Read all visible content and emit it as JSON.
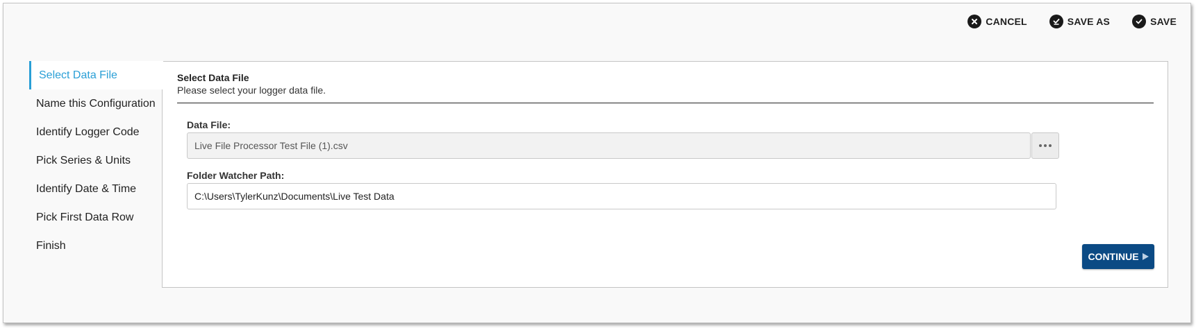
{
  "toolbar": {
    "cancel_label": "CANCEL",
    "save_as_label": "SAVE AS",
    "save_label": "SAVE"
  },
  "sidebar": {
    "items": [
      {
        "label": "Select Data File",
        "active": true
      },
      {
        "label": "Name this Configuration"
      },
      {
        "label": "Identify Logger Code"
      },
      {
        "label": "Pick Series & Units"
      },
      {
        "label": "Identify Date & Time"
      },
      {
        "label": "Pick First Data Row"
      },
      {
        "label": "Finish"
      }
    ]
  },
  "panel": {
    "title": "Select Data File",
    "subtitle": "Please select your logger data file.",
    "data_file": {
      "label": "Data File:",
      "value": "Live File Processor Test File (1).csv"
    },
    "folder_watcher": {
      "label": "Folder Watcher Path:",
      "value": "C:\\Users\\TylerKunz\\Documents\\Live Test Data"
    },
    "continue_label": "CONTINUE"
  },
  "colors": {
    "accent": "#2a9fd6",
    "primary_button": "#0b4a84"
  }
}
